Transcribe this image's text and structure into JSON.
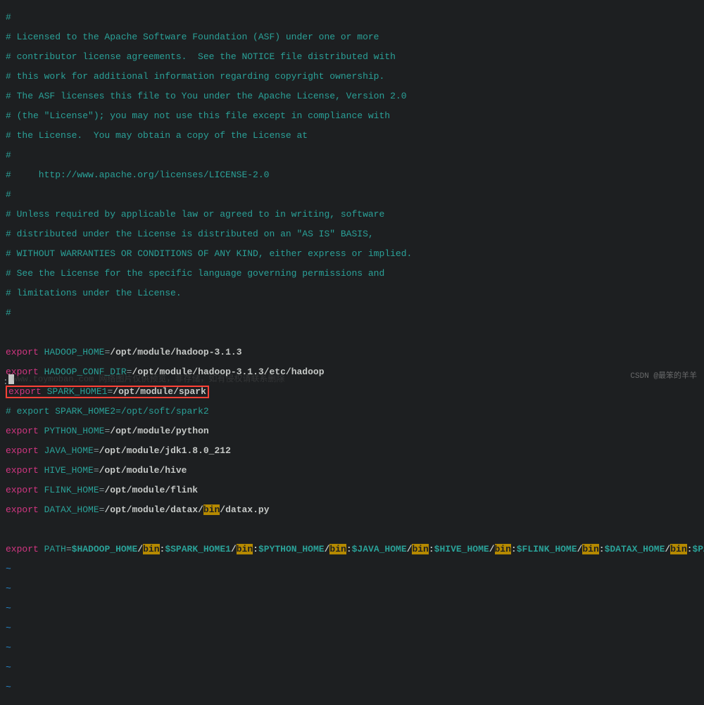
{
  "comments": {
    "c1": "#",
    "c2": "# Licensed to the Apache Software Foundation (ASF) under one or more",
    "c3": "# contributor license agreements.  See the NOTICE file distributed with",
    "c4": "# this work for additional information regarding copyright ownership.",
    "c5": "# The ASF licenses this file to You under the Apache License, Version 2.0",
    "c6": "# (the \"License\"); you may not use this file except in compliance with",
    "c7": "# the License.  You may obtain a copy of the License at",
    "c8": "#",
    "c9": "#     http://www.apache.org/licenses/LICENSE-2.0",
    "c10": "#",
    "c11": "# Unless required by applicable law or agreed to in writing, software",
    "c12": "# distributed under the License is distributed on an \"AS IS\" BASIS,",
    "c13": "# WITHOUT WARRANTIES OR CONDITIONS OF ANY KIND, either express or implied.",
    "c14": "# See the License for the specific language governing permissions and",
    "c15": "# limitations under the License.",
    "c16": "#",
    "c_spark2": "# export SPARK_HOME2=/opt/soft/spark2"
  },
  "kw": {
    "export": "export"
  },
  "env": {
    "hadoop": {
      "name": "HADOOP_HOME",
      "val": "/opt/module/hadoop-3.1.3"
    },
    "hadoop_conf": {
      "name": "HADOOP_CONF_DIR",
      "val": "/opt/module/hadoop-3.1.3/etc/hadoop"
    },
    "spark1": {
      "name": "SPARK_HOME1",
      "val": "/opt/module/spark"
    },
    "python": {
      "name": "PYTHON_HOME",
      "val": "/opt/module/python"
    },
    "java": {
      "name": "JAVA_HOME",
      "val": "/opt/module/jdk1.8.0_212"
    },
    "hive": {
      "name": "HIVE_HOME",
      "val": "/opt/module/hive"
    },
    "flink": {
      "name": "FLINK_HOME",
      "val": "/opt/module/flink"
    },
    "datax": {
      "name": "DATAX_HOME",
      "pre": "/opt/module/datax/",
      "mid": "bin",
      "post": "/datax.py"
    }
  },
  "path": {
    "name": "PATH",
    "eq": "=",
    "vars": [
      "$HADOOP_HOME",
      "$SPARK_HOME1",
      "$PYTHON_HOME",
      "$JAVA_HOME",
      "$HIVE_HOME",
      "$FLINK_HOME",
      "$DATAX_HOME",
      "$PATH"
    ],
    "slash": "/",
    "colon": ":",
    "bin": "bin"
  },
  "ui": {
    "tilde": "~",
    "colon": ":",
    "eq": "="
  },
  "watermark": {
    "left": "www.toymoban.com  网络图片仅供预览，非存储，如有侵权请联系删除",
    "right": "CSDN @最笨的羊羊"
  }
}
